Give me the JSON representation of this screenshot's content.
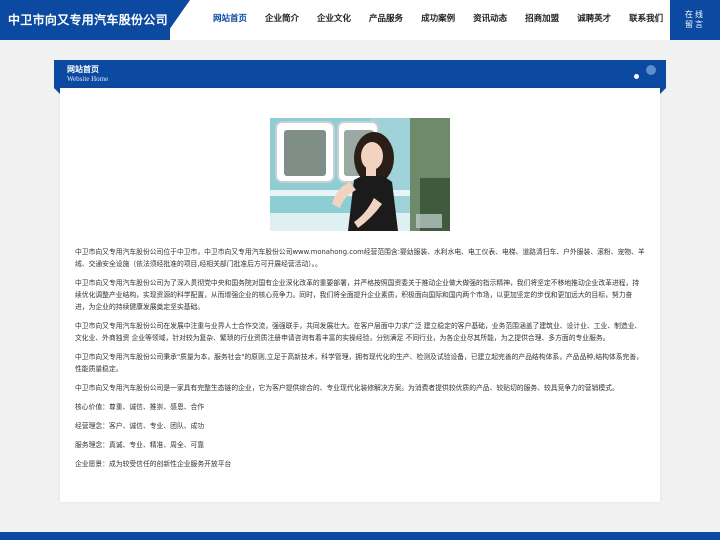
{
  "header": {
    "logo": "中卫市向又专用汽车股份公司",
    "nav": [
      "网站首页",
      "企业简介",
      "企业文化",
      "产品服务",
      "成功案例",
      "资讯动态",
      "招商加盟",
      "诚聘英才",
      "联系我们"
    ],
    "active_index": 0,
    "online_line1": "在线",
    "online_line2": "留言"
  },
  "band": {
    "title": "网站首页",
    "subtitle": "Website Home"
  },
  "content": {
    "paragraphs": [
      "中卫市向又专用汽车股份公司位于中卫市，中卫市向又专用汽车股份公司www.monahong.com经营范围含:婴幼服装、水利水电、电工仪表、电梯、道路清扫车、户外服装、滚粉、宠物、羊绒、交通安全设施（依法须经批准的项目,经相关部门批准后方可开展经营活动）。。",
      "中卫市向又专用汽车股份公司为了深入贯彻党中央和国务院对国有企业深化改革的重要部署，并严格按照国资委关于推动企业做大做强的指示精神，我们将坚定不移地推动企业改革进程，持续优化调整产业结构，实现资源的科学配置，从而增强企业的核心竞争力。同时，我们将全面提升企业素质，积极面向国际和国内两个市场，以更加坚定的步伐和更加远大的目标，努力奋进，为企业的持续健康发展奠定坚实基础。",
      "中卫市向又专用汽车股份公司在发展中注重与业界人士合作交流，强强联手，共同发展壮大。在客户层面中力求广泛 建立稳定的客户基础，业务范围涵盖了建筑业、设计业、工业、制造业、文化业、外商独资 企业等领域，针对较为复杂、繁琐的行业资质注册申请咨询有着丰富的实操经验，分别满足 不同行业，为各企业尽其所能，为之提供合理、多方面的专业服务。",
      "中卫市向又专用汽车股份公司秉承\"质量为本，服务社会\"的原则,立足于高新技术，科学管理，拥有现代化的生产、检测及试验设备，已建立起完善的产品结构体系，产品品种,结构体系完善，性能质量稳定。",
      "中卫市向又专用汽车股份公司是一家具有完整生态链的企业，它为客户提供综合的、专业现代化装修解决方案。为消费者提供较优质的产品、较贴切的服务、较具竞争力的营销模式。",
      "核心价值：尊重、诚信、推崇、感恩、合作",
      "经营理念：客户、诚信、专业、团队、成功",
      "服务理念：真诚、专业、精准、周全、可靠",
      "企业愿景：成为较受信任的创新性企业服务开放平台"
    ]
  },
  "colors": {
    "brand": "#0b4aa0",
    "background": "#f1f1f1"
  }
}
